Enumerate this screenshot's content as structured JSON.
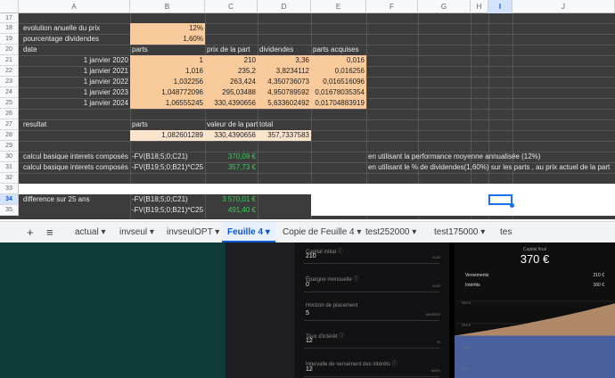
{
  "columns": [
    "A",
    "B",
    "C",
    "D",
    "E",
    "F",
    "G",
    "H",
    "I",
    "J"
  ],
  "rows": [
    "17",
    "18",
    "19",
    "20",
    "21",
    "22",
    "23",
    "24",
    "25",
    "26",
    "27",
    "28",
    "29",
    "30",
    "31",
    "32",
    "33",
    "34",
    "35"
  ],
  "cells": {
    "a18": "evolution anuelle du prix",
    "b18": "12%",
    "a19": "pourcentage dividendes",
    "b19": "1,60%",
    "a20": "date",
    "b20": "parts",
    "c20": "prix de la part",
    "d20": "dividendes",
    "e20": "parts acquises",
    "a21": "1 janvier 2020",
    "b21": "1",
    "c21": "210",
    "d21": "3,36",
    "e21": "0,016",
    "a22": "1 janvier 2021",
    "b22": "1,016",
    "c22": "235,2",
    "d22": "3,8234112",
    "e22": "0,016256",
    "a23": "1 janvier 2022",
    "b23": "1,032256",
    "c23": "263,424",
    "d23": "4,350736073",
    "e23": "0,016516096",
    "a24": "1 janvier 2023",
    "b24": "1,048772096",
    "c24": "295,03488",
    "d24": "4,950789592",
    "e24": "0,01678035354",
    "a25": "1 janvier 2024",
    "b25": "1,06555245",
    "c25": "330,4390656",
    "d25": "5,633602492",
    "e25": "0,01704883919",
    "a27": "resultat",
    "b27": "parts",
    "c27": "valeur de la part",
    "d27": "total",
    "b28": "1,082601289",
    "c28": "330,4390656",
    "d28": "357,7337583",
    "a30": "calcul basique interets composés",
    "b30": "-FV(B18;5;0;C21)",
    "c30": "370,09 €",
    "f30": "en utilisant la performance moyenne annualisée (12%)",
    "a31": "calcul basique interets composés",
    "b31": "-FV(B19;5;0;B21)*C25",
    "c31": "357,73 €",
    "f31": "en utilisant le % de dividendes(1,60%) sur les parts , au prix actuel de la part",
    "a34": "difference sur 25 ans",
    "b34": "-FV(B18;5;0;C21)",
    "c34": "3 570,01 €",
    "b35": "-FV(B19;5;0;B21)*C25",
    "c35": "491,40 €"
  },
  "tabs": {
    "add": "+",
    "menu": "≡",
    "t1": "actual",
    "t2": "invseul",
    "t3": "invseulOPT",
    "t4": "Feuille 4",
    "t5": "Copie de Feuille 4",
    "t6": "test252000",
    "t7": "test175000",
    "t8": "tes"
  },
  "app": {
    "capital_label": "Capital initial",
    "capital_value": "210",
    "capital_unit": "EUR",
    "epargne_label": "Épargne mensuelle",
    "epargne_value": "0",
    "epargne_unit": "EUR",
    "horizon_label": "Horizon de placement",
    "horizon_value": "5",
    "horizon_unit": "ANNÉES",
    "taux_label": "Taux d'intérêt",
    "taux_value": "12",
    "taux_unit": "%",
    "intervalle_label": "Intervalle de versement des intérêts",
    "intervalle_value": "12",
    "intervalle_unit": "MOIS",
    "final_label": "Capital final",
    "final_value": "370 €",
    "versements_label": "Versements",
    "versements_value": "210 €",
    "interets_label": "Intérêts",
    "interets_value": "160 €",
    "y1": "380 €",
    "y2": "285 €",
    "y3": "190 €",
    "y4": "95 €"
  },
  "chart_data": {
    "type": "area",
    "series": [
      {
        "values": [
          210,
          235,
          263,
          295,
          330,
          370
        ]
      }
    ]
  },
  "colors": {
    "accent": "#1a73e8",
    "peach": "#f9cb9c",
    "green": "#34d058",
    "interest_area": "#b08a68",
    "deposit_area": "#4a5f9e"
  }
}
